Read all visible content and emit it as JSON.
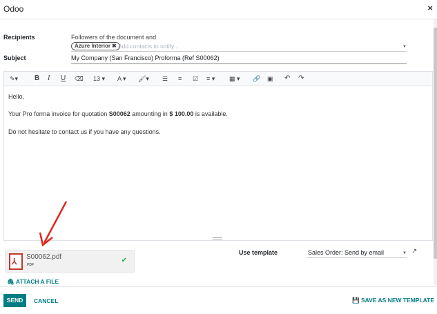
{
  "dialog": {
    "title": "Odoo",
    "close_glyph": "×"
  },
  "recipients": {
    "label": "Recipients",
    "text": "Followers of the document and",
    "tag": "Azure Interior",
    "placeholder": "Add contacts to notify..."
  },
  "subject": {
    "label": "Subject",
    "value": "My Company (San Francisco) Proforma (Ref S00062)"
  },
  "toolbar": {
    "magic": "✎▾",
    "bold": "B",
    "italic": "I",
    "underline": "U",
    "eraser": "⌫",
    "font_size": "13 ▾",
    "font_color": "A ▾",
    "brush": "🖌▾",
    "bullet_list": "☰",
    "numbered_list": "≡",
    "checklist": "☑",
    "align": "≡ ▾",
    "table": "▦ ▾",
    "link": "🔗",
    "image": "▣",
    "undo": "↶",
    "redo": "↷"
  },
  "body": {
    "greeting": "Hello,",
    "line_pre": "Your Pro forma invoice for quotation ",
    "quotation": "S00062",
    "line_mid": " amounting in ",
    "amount": "$ 100.00",
    "line_post": " is available.",
    "closing": "Do not hesitate to contact us if you have any questions."
  },
  "attachment": {
    "filename": "S00062.pdf",
    "type": "PDF",
    "icon_glyph": "⅄",
    "check_glyph": "✔"
  },
  "attach_link": "🖇 ATTACH A FILE",
  "template": {
    "label": "Use template",
    "value": "Sales Order: Send by email",
    "ext_glyph": "↗"
  },
  "footer": {
    "send": "SEND",
    "cancel": "CANCEL",
    "save_template": "💾 SAVE AS NEW TEMPLATE"
  },
  "colors": {
    "accent": "#017e84",
    "arrow": "#e0261c",
    "pdf": "#c0392b"
  }
}
